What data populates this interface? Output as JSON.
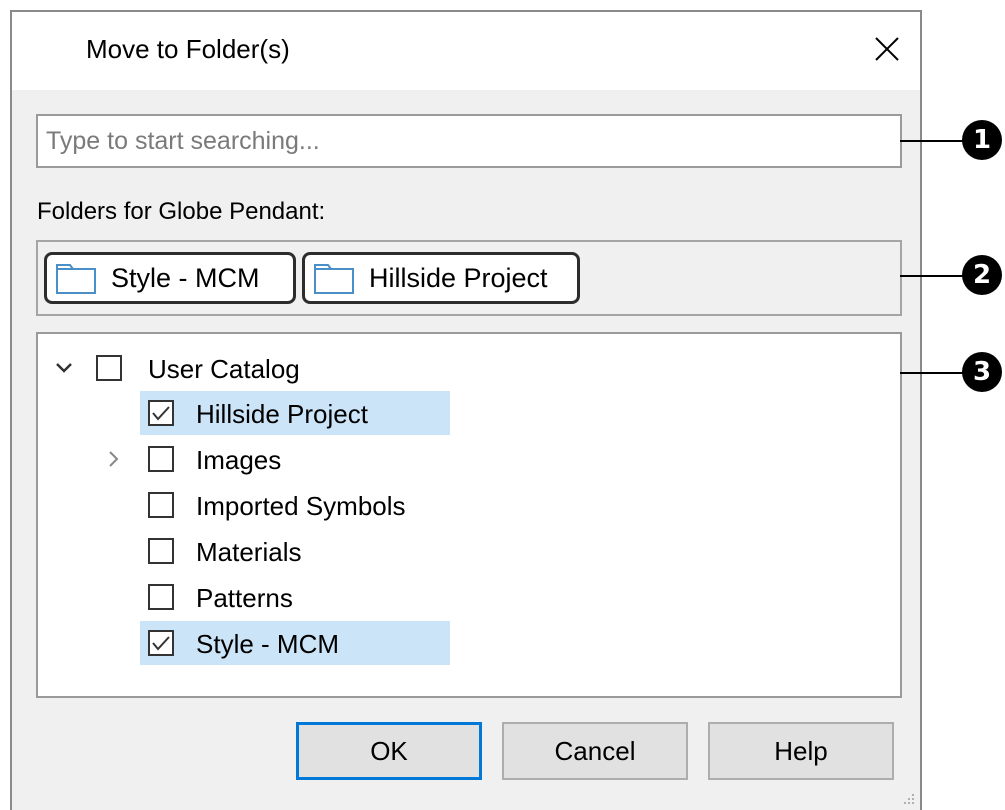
{
  "dialog": {
    "title": "Move to Folder(s)"
  },
  "search": {
    "placeholder": "Type to start searching..."
  },
  "folders_label": "Folders for Globe Pendant:",
  "chips": [
    {
      "label": "Style - MCM",
      "icon": "folder-icon"
    },
    {
      "label": "Hillside Project",
      "icon": "folder-icon"
    }
  ],
  "tree": {
    "root": {
      "label": "User Catalog",
      "expanded": true,
      "checked": false
    },
    "children": [
      {
        "label": "Hillside Project",
        "checked": true,
        "selected": true,
        "has_children": false
      },
      {
        "label": "Images",
        "checked": false,
        "selected": false,
        "has_children": true
      },
      {
        "label": "Imported Symbols",
        "checked": false,
        "selected": false,
        "has_children": false
      },
      {
        "label": "Materials",
        "checked": false,
        "selected": false,
        "has_children": false
      },
      {
        "label": "Patterns",
        "checked": false,
        "selected": false,
        "has_children": false
      },
      {
        "label": "Style - MCM",
        "checked": true,
        "selected": true,
        "has_children": false
      }
    ]
  },
  "buttons": {
    "ok": "OK",
    "cancel": "Cancel",
    "help": "Help"
  },
  "callouts": [
    "1",
    "2",
    "3"
  ],
  "colors": {
    "accent": "#0078d7",
    "selection": "#cce4f7",
    "dialog_bg": "#f0f0f0"
  }
}
